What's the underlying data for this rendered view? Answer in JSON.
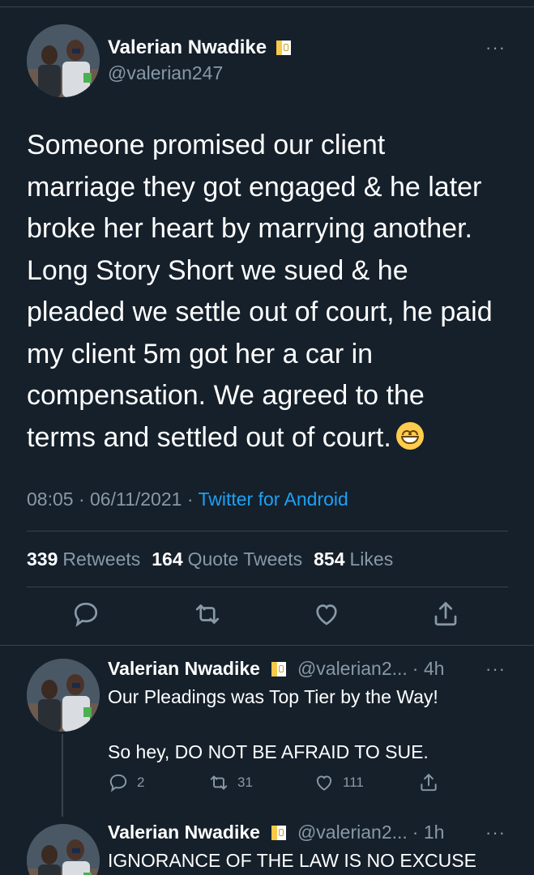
{
  "main_tweet": {
    "author_name": "Valerian Nwadike",
    "author_handle": "@valerian247",
    "text": "Someone promised our client\nmarriage they got engaged & he later\nbroke her heart by marrying another.\nLong Story Short we sued & he\npleaded we settle out of court, he paid\nmy client 5m got her a car in\ncompensation. We agreed to the\nterms and settled out of court.",
    "emoji": "grinning-face-with-smiling-eyes",
    "time": "08:05",
    "date": "06/11/2021",
    "separator": "·",
    "source": "Twitter for Android",
    "stats": {
      "retweets_count": "339",
      "retweets_label": "Retweets",
      "quotes_count": "164",
      "quotes_label": "Quote Tweets",
      "likes_count": "854",
      "likes_label": "Likes"
    },
    "more_label": "···"
  },
  "replies": [
    {
      "author_name": "Valerian Nwadike",
      "author_handle": "@valerian2...",
      "time": "· 4h",
      "text": "Our Pleadings was Top Tier by the Way!\n\nSo hey, DO NOT BE AFRAID TO SUE.",
      "reply_count": "2",
      "retweet_count": "31",
      "like_count": "111",
      "more_label": "···"
    },
    {
      "author_name": "Valerian Nwadike",
      "author_handle": "@valerian2...",
      "time": "· 1h",
      "text": "IGNORANCE OF THE LAW IS NO EXCUSE",
      "more_label": "···"
    }
  ],
  "icons": {
    "reply": "reply-icon",
    "retweet": "retweet-icon",
    "like": "heart-icon",
    "share": "share-icon",
    "verified_flag": "flag-icon"
  },
  "colors": {
    "background": "#15202b",
    "text_primary": "#ffffff",
    "text_secondary": "#8899a6",
    "accent": "#1da1f2",
    "divider": "#38444d"
  }
}
